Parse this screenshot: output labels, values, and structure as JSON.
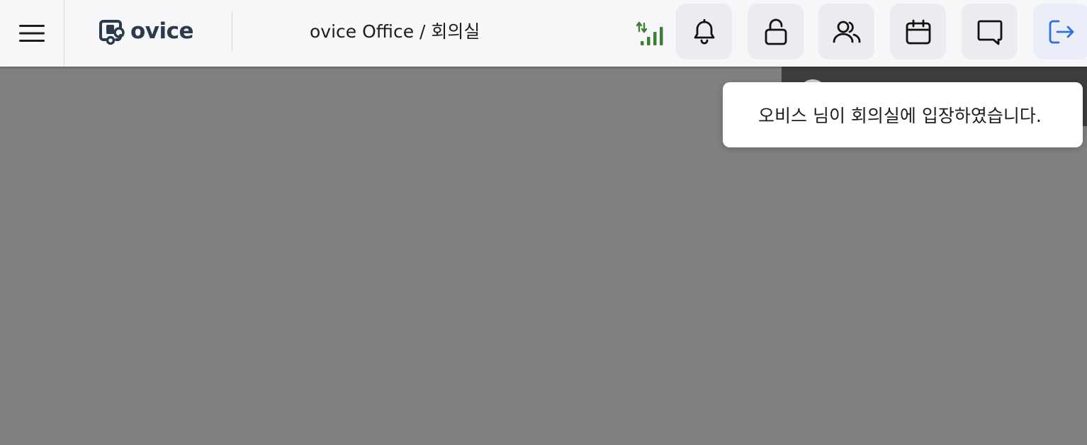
{
  "header": {
    "logo_text": "ovice",
    "space_title": "ovice Office / 회의실"
  },
  "icons": {
    "menu": "hamburger-menu-icon",
    "logo": "ovice-logo-icon",
    "signal": "network-signal-icon",
    "notifications": "bell-icon",
    "lock": "unlock-icon",
    "members": "users-icon",
    "calendar": "calendar-icon",
    "chat": "chat-bubble-icon",
    "exit": "logout-icon"
  },
  "colors": {
    "header_bg": "#f7f7f9",
    "canvas_bg": "#808080",
    "signal_green": "#3f7d3a",
    "exit_blue": "#2f6fe0",
    "text_dark": "#1d1d1f",
    "logo_dark": "#2b3a4c"
  },
  "toast": {
    "message": "오비스 님이 회의실에 입장하였습니다."
  }
}
